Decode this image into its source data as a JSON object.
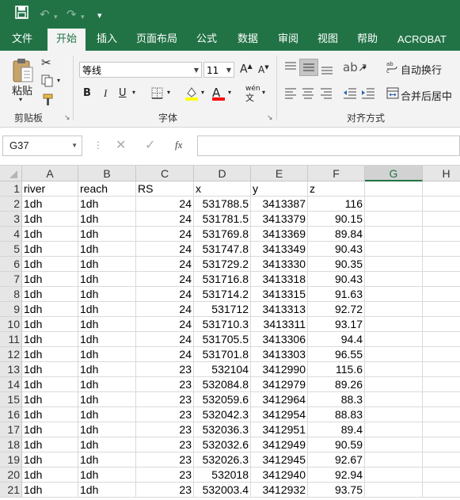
{
  "quick_access": {
    "save_icon": "save-icon",
    "undo_icon": "undo-icon",
    "redo_icon": "redo-icon",
    "customize_icon": "customize-toolbar-icon"
  },
  "tabs": [
    {
      "label": "文件",
      "active": false
    },
    {
      "label": "开始",
      "active": true
    },
    {
      "label": "插入",
      "active": false
    },
    {
      "label": "页面布局",
      "active": false
    },
    {
      "label": "公式",
      "active": false
    },
    {
      "label": "数据",
      "active": false
    },
    {
      "label": "审阅",
      "active": false
    },
    {
      "label": "视图",
      "active": false
    },
    {
      "label": "帮助",
      "active": false
    },
    {
      "label": "ACROBAT",
      "active": false
    }
  ],
  "ribbon": {
    "clipboard": {
      "paste_label": "粘贴",
      "group_label": "剪贴板"
    },
    "font": {
      "name": "等线",
      "size": "11",
      "group_label": "字体",
      "bold": "B",
      "italic": "I",
      "underline": "U",
      "grow": "A",
      "shrink": "A",
      "color_letter": "A",
      "phonetic": "wén"
    },
    "alignment": {
      "wrap_label": "自动换行",
      "merge_label": "合并后居中",
      "group_label": "对齐方式"
    }
  },
  "formula_bar": {
    "name_box": "G37",
    "fx_label": "fx",
    "content": ""
  },
  "colors": {
    "brand": "#217346",
    "highlight": "#FFFF00",
    "font_color": "#FF0000"
  },
  "sheet": {
    "columns": [
      "A",
      "B",
      "C",
      "D",
      "E",
      "F",
      "G",
      "H"
    ],
    "selected_column": "G",
    "rows": [
      [
        "river",
        "reach",
        "RS",
        "x",
        "y",
        "z"
      ],
      [
        "1dh",
        "1dh",
        "24",
        "531788.5",
        "3413387",
        "116"
      ],
      [
        "1dh",
        "1dh",
        "24",
        "531781.5",
        "3413379",
        "90.15"
      ],
      [
        "1dh",
        "1dh",
        "24",
        "531769.8",
        "3413369",
        "89.84"
      ],
      [
        "1dh",
        "1dh",
        "24",
        "531747.8",
        "3413349",
        "90.43"
      ],
      [
        "1dh",
        "1dh",
        "24",
        "531729.2",
        "3413330",
        "90.35"
      ],
      [
        "1dh",
        "1dh",
        "24",
        "531716.8",
        "3413318",
        "90.43"
      ],
      [
        "1dh",
        "1dh",
        "24",
        "531714.2",
        "3413315",
        "91.63"
      ],
      [
        "1dh",
        "1dh",
        "24",
        "531712",
        "3413313",
        "92.72"
      ],
      [
        "1dh",
        "1dh",
        "24",
        "531710.3",
        "3413311",
        "93.17"
      ],
      [
        "1dh",
        "1dh",
        "24",
        "531705.5",
        "3413306",
        "94.4"
      ],
      [
        "1dh",
        "1dh",
        "24",
        "531701.8",
        "3413303",
        "96.55"
      ],
      [
        "1dh",
        "1dh",
        "23",
        "532104",
        "3412990",
        "115.6"
      ],
      [
        "1dh",
        "1dh",
        "23",
        "532084.8",
        "3412979",
        "89.26"
      ],
      [
        "1dh",
        "1dh",
        "23",
        "532059.6",
        "3412964",
        "88.3"
      ],
      [
        "1dh",
        "1dh",
        "23",
        "532042.3",
        "3412954",
        "88.83"
      ],
      [
        "1dh",
        "1dh",
        "23",
        "532036.3",
        "3412951",
        "89.4"
      ],
      [
        "1dh",
        "1dh",
        "23",
        "532032.6",
        "3412949",
        "90.59"
      ],
      [
        "1dh",
        "1dh",
        "23",
        "532026.3",
        "3412945",
        "92.67"
      ],
      [
        "1dh",
        "1dh",
        "23",
        "532018",
        "3412940",
        "92.94"
      ],
      [
        "1dh",
        "1dh",
        "23",
        "532003.4",
        "3412932",
        "93.75"
      ]
    ]
  }
}
